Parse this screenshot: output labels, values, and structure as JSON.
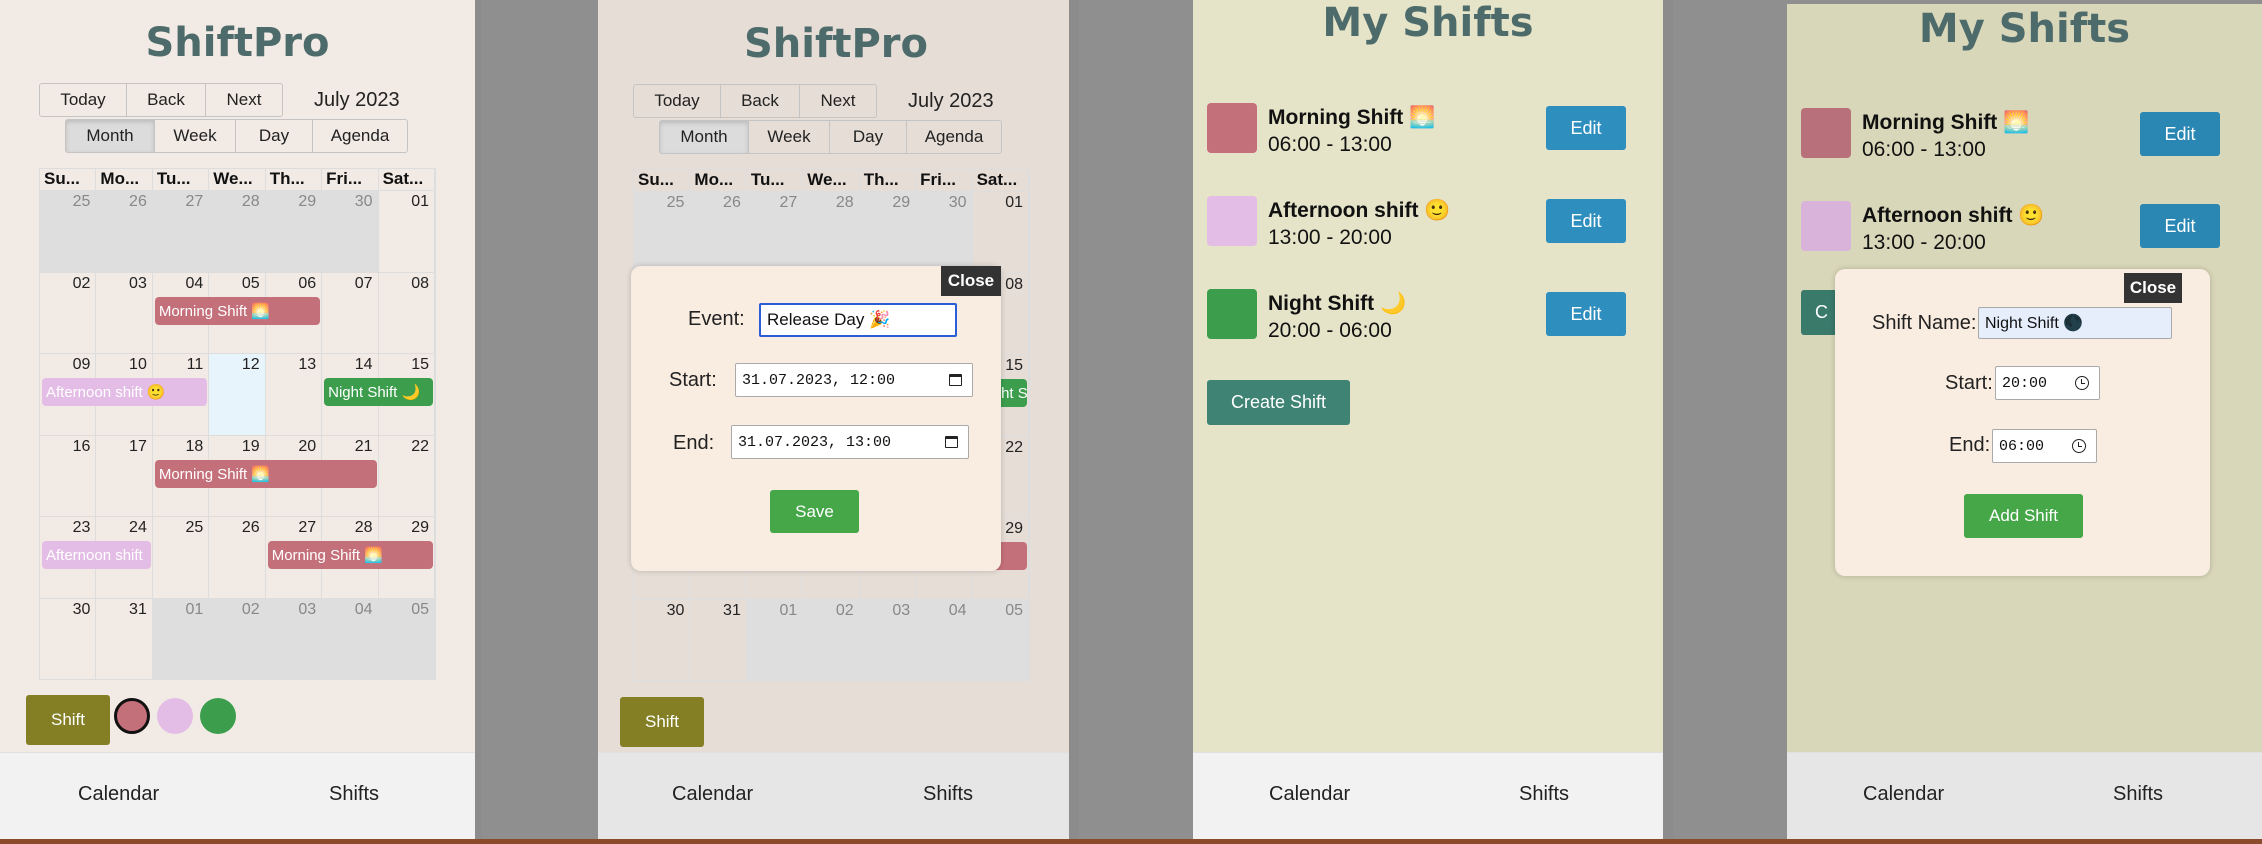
{
  "brand": "ShiftPro",
  "calendar": {
    "toolbar": {
      "today": "Today",
      "back": "Back",
      "next": "Next",
      "month_label": "July 2023"
    },
    "views": [
      "Month",
      "Week",
      "Day",
      "Agenda"
    ],
    "active_view": "Month",
    "weekday_headers": [
      "Su...",
      "Mo...",
      "Tu...",
      "We...",
      "Th...",
      "Fri...",
      "Sat..."
    ],
    "weeks": [
      [
        "25",
        "26",
        "27",
        "28",
        "29",
        "30",
        "01"
      ],
      [
        "02",
        "03",
        "04",
        "05",
        "06",
        "07",
        "08"
      ],
      [
        "09",
        "10",
        "11",
        "12",
        "13",
        "14",
        "15"
      ],
      [
        "16",
        "17",
        "18",
        "19",
        "20",
        "21",
        "22"
      ],
      [
        "23",
        "24",
        "25",
        "26",
        "27",
        "28",
        "29"
      ],
      [
        "30",
        "31",
        "01",
        "02",
        "03",
        "04",
        "05"
      ]
    ],
    "today_date": "12",
    "events": {
      "morning": "Morning Shift 🌅",
      "afternoon": "Afternoon shift 🙂",
      "afternoon_cut": "Afternoon shift",
      "night": "Night Shift 🌙"
    },
    "shift_button": "Shift",
    "legend_colors": [
      "#c4707a",
      "#e4bde6",
      "#3c9e4d"
    ]
  },
  "event_modal": {
    "close": "Close",
    "event_label": "Event:",
    "event_value": "Release Day 🎉",
    "start_label": "Start:",
    "start_value": "31.07.2023, 12:00",
    "end_label": "End:",
    "end_value": "31.07.2023, 13:00",
    "save": "Save"
  },
  "nav": {
    "calendar": "Calendar",
    "shifts": "Shifts"
  },
  "shifts_page": {
    "title": "My Shifts",
    "shifts": [
      {
        "name": "Morning Shift 🌅",
        "time": "06:00 - 13:00",
        "color": "#c4707a"
      },
      {
        "name": "Afternoon shift 🙂",
        "time": "13:00 - 20:00",
        "color": "#e4bde6"
      },
      {
        "name": "Night Shift 🌙",
        "time": "20:00 - 06:00",
        "color": "#3c9e4d"
      }
    ],
    "edit": "Edit",
    "create": "Create Shift",
    "create_cut": "C"
  },
  "shift_modal": {
    "close": "Close",
    "name_label": "Shift Name:",
    "name_value": "Night Shift 🌑",
    "start_label": "Start:",
    "start_value": "20:00",
    "end_label": "End:",
    "end_value": "06:00",
    "add": "Add Shift"
  },
  "colors": {
    "calendar_bg": "#f2eae4",
    "shifts_bg": "#e5e4c8",
    "accent_green": "#46a749",
    "edit_blue": "#2e8fbf"
  }
}
